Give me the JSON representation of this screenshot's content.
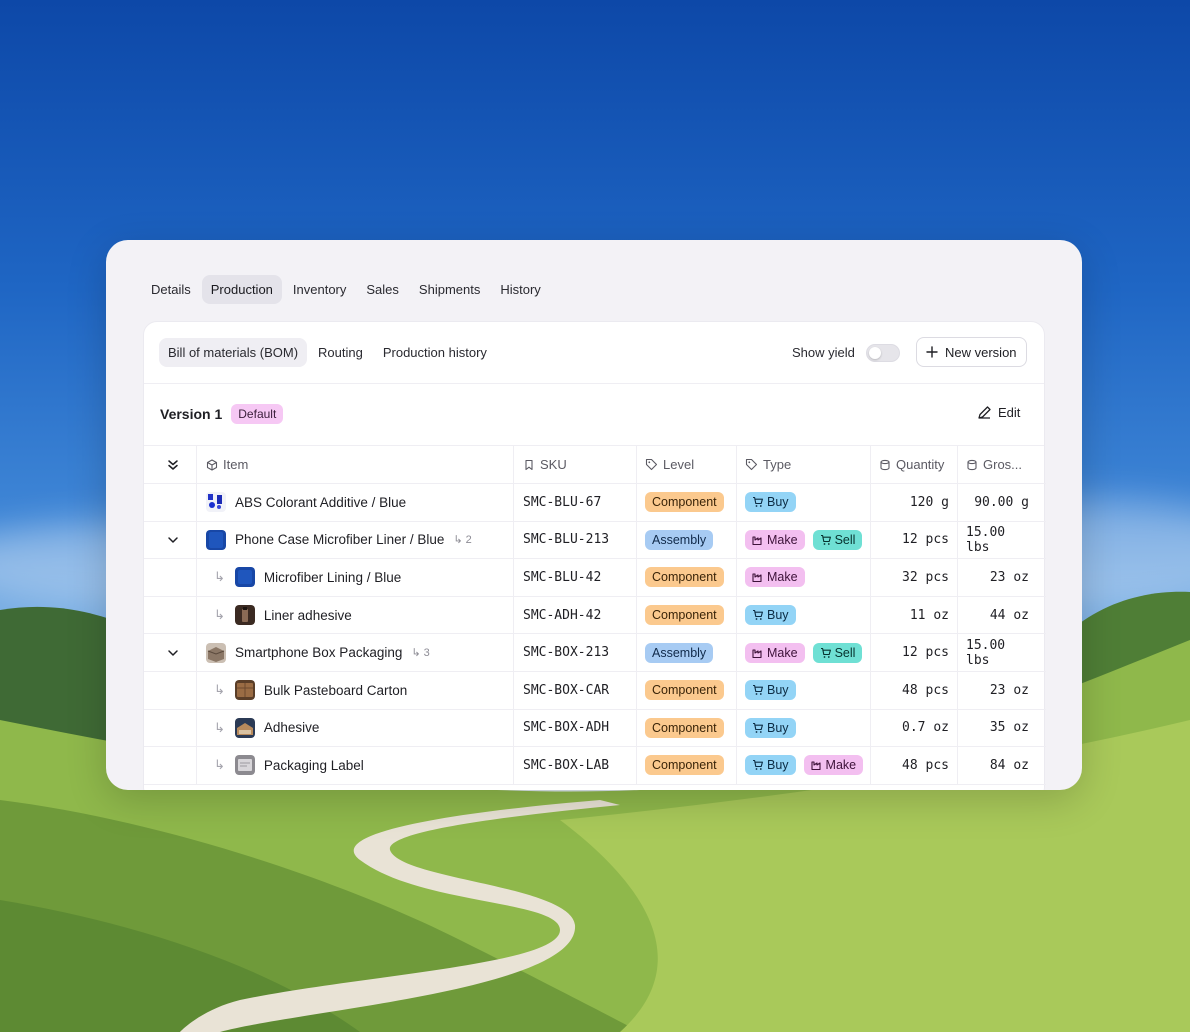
{
  "top_tabs": [
    "Details",
    "Production",
    "Inventory",
    "Sales",
    "Shipments",
    "History"
  ],
  "sub_tabs": [
    "Bill of materials (BOM)",
    "Routing",
    "Production history"
  ],
  "controls": {
    "show_yield_label": "Show yield",
    "new_version_label": "New version",
    "edit_label": "Edit"
  },
  "version": {
    "title": "Version 1",
    "badge": "Default"
  },
  "columns": {
    "item": "Item",
    "sku": "SKU",
    "level": "Level",
    "type": "Type",
    "quantity": "Quantity",
    "gross": "Gros..."
  },
  "rows": [
    {
      "name": "ABS Colorant Additive / Blue",
      "sku": "SMC-BLU-67",
      "level": "Component",
      "types": [
        "Buy"
      ],
      "quantity": "120 g",
      "gross": "90.00 g"
    },
    {
      "name": "Phone Case Microfiber Liner / Blue",
      "child_count": "2",
      "sku": "SMC-BLU-213",
      "level": "Assembly",
      "types": [
        "Make",
        "Sell"
      ],
      "quantity": "12 pcs",
      "gross": "15.00 lbs"
    },
    {
      "name": "Microfiber Lining / Blue",
      "sku": "SMC-BLU-42",
      "level": "Component",
      "types": [
        "Make"
      ],
      "quantity": "32 pcs",
      "gross": "23 oz"
    },
    {
      "name": "Liner adhesive",
      "sku": "SMC-ADH-42",
      "level": "Component",
      "types": [
        "Buy"
      ],
      "quantity": "11 oz",
      "gross": "44 oz"
    },
    {
      "name": "Smartphone Box Packaging",
      "child_count": "3",
      "sku": "SMC-BOX-213",
      "level": "Assembly",
      "types": [
        "Make",
        "Sell"
      ],
      "quantity": "12 pcs",
      "gross": "15.00 lbs"
    },
    {
      "name": "Bulk Pasteboard Carton",
      "sku": "SMC-BOX-CAR",
      "level": "Component",
      "types": [
        "Buy"
      ],
      "quantity": "48 pcs",
      "gross": "23 oz"
    },
    {
      "name": "Adhesive",
      "sku": "SMC-BOX-ADH",
      "level": "Component",
      "types": [
        "Buy"
      ],
      "quantity": "0.7 oz",
      "gross": "35 oz"
    },
    {
      "name": "Packaging Label",
      "sku": "SMC-BOX-LAB",
      "level": "Component",
      "types": [
        "Buy",
        "Make"
      ],
      "quantity": "48 pcs",
      "gross": "84 oz"
    }
  ],
  "colors": {
    "component": "#fbc98e",
    "assembly": "#a7cbf3",
    "buy": "#93d4f6",
    "make": "#f3bff0",
    "sell": "#6fe0d4",
    "default_badge": "#f6c8f4"
  }
}
